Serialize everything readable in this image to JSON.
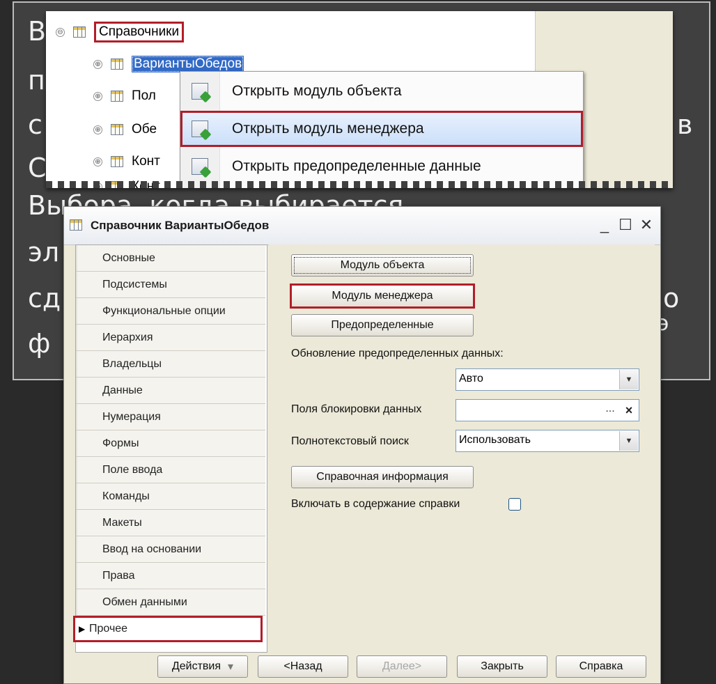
{
  "background_text": [
    "В",
    "п",
    "с",
    "С",
    "Выбора, когда выбирается",
    "эл",
    "сд",
    "ф",
    "в",
    "о",
    "э"
  ],
  "tree": {
    "root": {
      "expander": "⊖",
      "label": "Справочники"
    },
    "rows": [
      {
        "expander": "⊕",
        "label": "ВариантыОбедов"
      },
      {
        "expander": "⊕",
        "label": "Пол"
      },
      {
        "expander": "⊕",
        "label": "Обе"
      },
      {
        "expander": "⊕",
        "label": "Конт"
      },
      {
        "expander": "⊕",
        "label": "Конт"
      }
    ]
  },
  "context_menu": {
    "items": [
      {
        "label": "Открыть модуль объекта"
      },
      {
        "label": "Открыть модуль менеджера"
      },
      {
        "label": "Открыть предопределенные данные"
      }
    ]
  },
  "dialog": {
    "title": "Справочник ВариантыОбедов",
    "window_controls": {
      "minimize": "_",
      "maximize": "☐",
      "close": "✕"
    },
    "sidebar": {
      "items": [
        "Основные",
        "Подсистемы",
        "Функциональные опции",
        "Иерархия",
        "Владельцы",
        "Данные",
        "Нумерация",
        "Формы",
        "Поле ввода",
        "Команды",
        "Макеты",
        "Ввод на основании",
        "Права",
        "Обмен данными",
        "Прочее"
      ],
      "active_marker": "▶"
    },
    "content": {
      "object_module_button": "Модуль объекта",
      "manager_module_button": "Модуль менеджера",
      "predefined_button": "Предопределенные",
      "update_predefined_label": "Обновление предопределенных данных:",
      "update_predefined_value": "Авто",
      "lock_fields_label": "Поля блокировки данных",
      "lock_fields_value": "",
      "dots_glyph": "...",
      "clear_glyph": "×",
      "fulltext_label": "Полнотекстовый поиск",
      "fulltext_value": "Использовать",
      "dropdown_glyph": "▼",
      "help_info_button": "Справочная информация",
      "include_help_label": "Включать в содержание справки"
    },
    "footer": {
      "actions": "Действия",
      "actions_arrow": "▾",
      "back": "<Назад",
      "next": "Далее>",
      "close": "Закрыть",
      "help": "Справка"
    }
  },
  "colors": {
    "highlight_red": "#b21d28",
    "selection_blue": "#3169c6",
    "slide_panel": "#404040",
    "dialog_bg": "#ece9d8"
  }
}
